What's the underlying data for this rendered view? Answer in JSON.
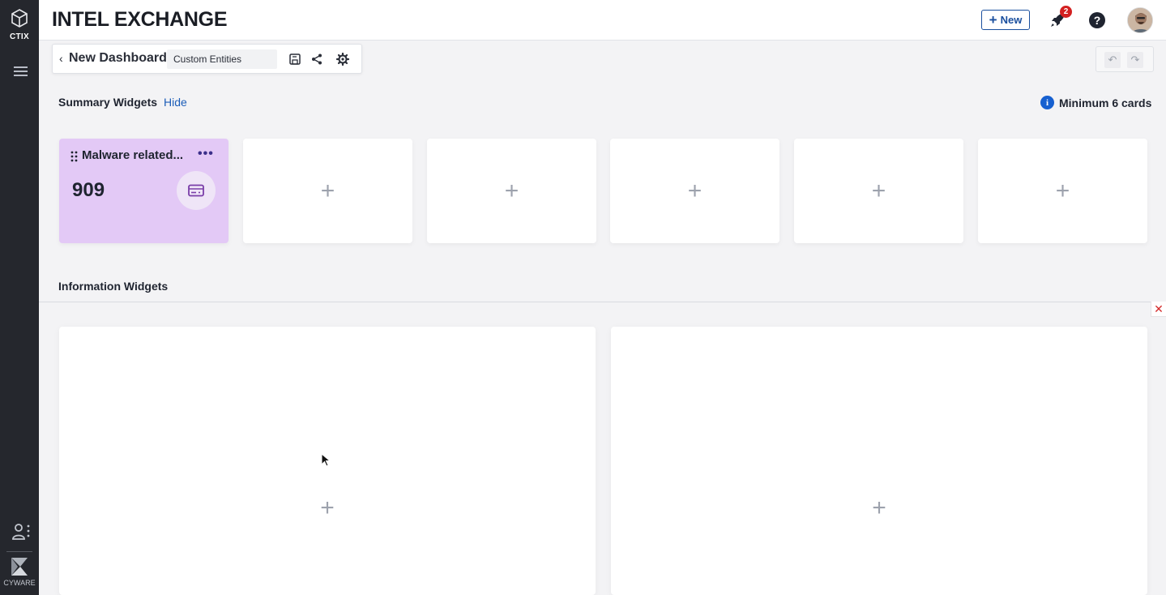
{
  "app": {
    "brand_label": "CTIX",
    "title": "INTEL EXCHANGE",
    "vendor_label": "CYWARE"
  },
  "topbar": {
    "new_label": "New",
    "notification_count": "2",
    "help_glyph": "?"
  },
  "dashboard": {
    "title": "New Dashboard",
    "selector_value": "Custom Entities",
    "tools": [
      "save-icon",
      "share-icon",
      "settings-icon"
    ],
    "undo_glyph": "↶",
    "redo_glyph": "↷"
  },
  "summary": {
    "label": "Summary Widgets",
    "hide_label": "Hide",
    "min_note": "Minimum 6 cards",
    "info_glyph": "i",
    "card": {
      "title": "Malware related...",
      "menu_glyph": "•••",
      "value": "909",
      "icon": "card-icon",
      "color": "#e3c9f6"
    },
    "empty_glyph": "+"
  },
  "info": {
    "label": "Information Widgets",
    "close_glyph": "✕",
    "empty_glyph": "+"
  },
  "colors": {
    "sidebar": "#25272d",
    "accent": "#1a4f9e",
    "badge": "#d32020"
  }
}
